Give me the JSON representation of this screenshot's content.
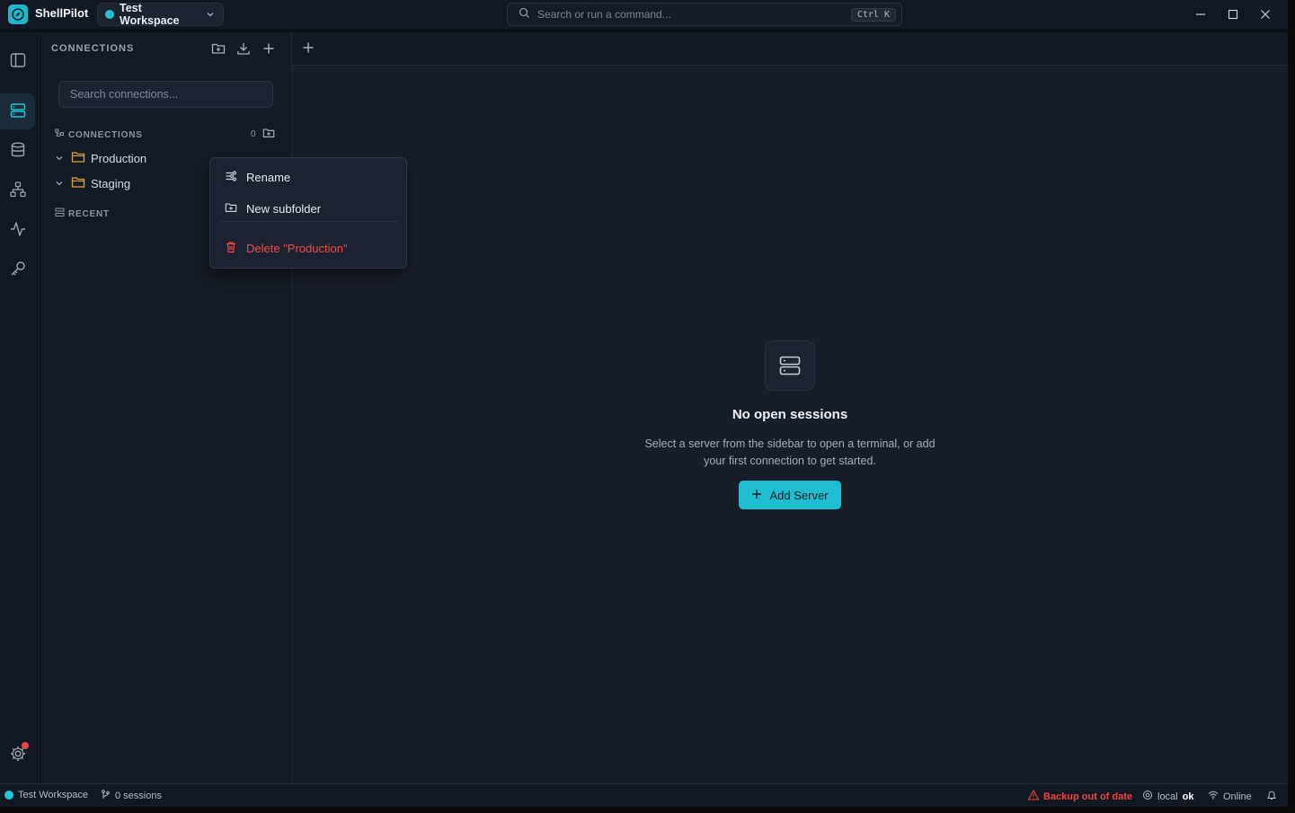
{
  "app": {
    "name": "ShellPilot"
  },
  "workspace": {
    "name": "Test Workspace"
  },
  "command": {
    "placeholder": "Search or run a command...",
    "shortcut": "Ctrl K"
  },
  "activity_bar": {
    "items": [
      {
        "name": "toggle-sidebar",
        "icon": "panel-left-icon"
      },
      {
        "name": "connections",
        "icon": "server-icon",
        "active": true
      },
      {
        "name": "databases",
        "icon": "database-icon"
      },
      {
        "name": "network",
        "icon": "network-icon"
      },
      {
        "name": "monitoring",
        "icon": "activity-icon"
      },
      {
        "name": "keys",
        "icon": "key-icon"
      }
    ],
    "settings_icon": "gear-icon"
  },
  "sidebar": {
    "header": "CONNECTIONS",
    "search_placeholder": "Search connections...",
    "connections_label": "CONNECTIONS",
    "connections_count": "0",
    "folders": [
      {
        "label": "Production"
      },
      {
        "label": "Staging"
      }
    ],
    "recent_label": "RECENT"
  },
  "context_menu": {
    "items": [
      {
        "label": "Rename",
        "icon": "rename-icon"
      },
      {
        "label": "New subfolder",
        "icon": "folder-plus-icon"
      },
      {
        "label": "Delete \"Production\"",
        "icon": "trash-icon",
        "danger": true
      }
    ]
  },
  "main": {
    "empty_title": "No open sessions",
    "empty_desc": "Select a server from the sidebar to open a terminal, or add your first connection to get started.",
    "add_button": "Add Server"
  },
  "statusbar": {
    "workspace": "Test Workspace",
    "sessions": "0 sessions",
    "backup_warning": "Backup out of date",
    "local_label": "local",
    "local_status": "ok",
    "network_status": "Online"
  },
  "colors": {
    "accent": "#1fbdd0",
    "danger": "#ef4444",
    "folder": "#e0a030"
  }
}
